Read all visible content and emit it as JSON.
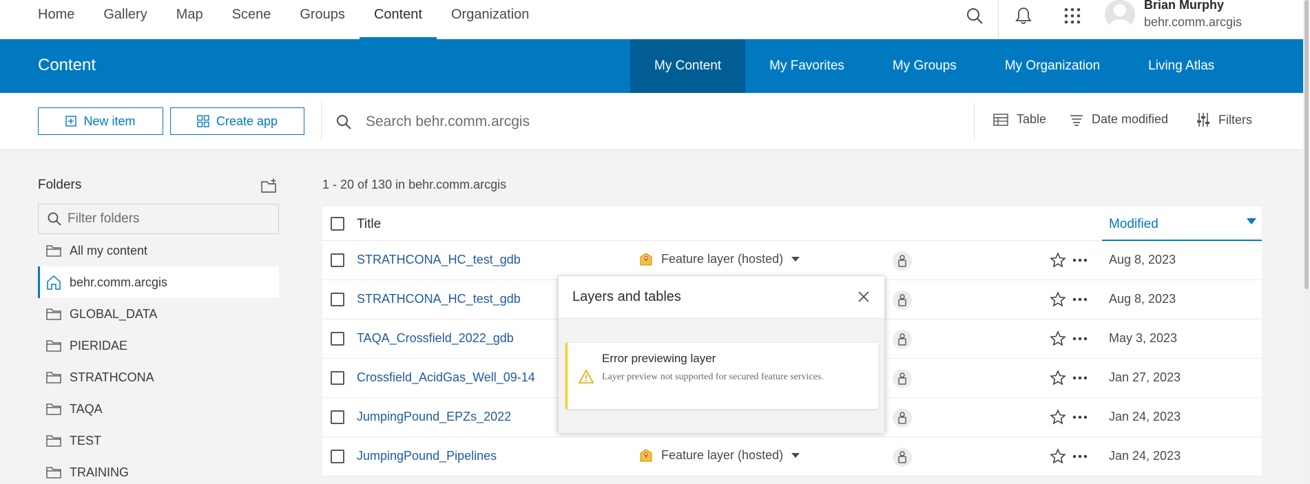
{
  "topnav": {
    "items": [
      {
        "label": "Home"
      },
      {
        "label": "Gallery"
      },
      {
        "label": "Map"
      },
      {
        "label": "Scene"
      },
      {
        "label": "Groups"
      },
      {
        "label": "Content",
        "active": true
      },
      {
        "label": "Organization"
      }
    ],
    "user": {
      "name": "Brian Murphy",
      "org": "behr.comm.arcgis"
    }
  },
  "header": {
    "title": "Content",
    "tabs": [
      {
        "label": "My Content",
        "active": true
      },
      {
        "label": "My Favorites"
      },
      {
        "label": "My Groups"
      },
      {
        "label": "My Organization"
      },
      {
        "label": "Living Atlas"
      }
    ]
  },
  "toolbar": {
    "new_item_label": "New item",
    "create_app_label": "Create app",
    "search_placeholder": "Search behr.comm.arcgis",
    "view_label": "Table",
    "sort_label": "Date modified",
    "filters_label": "Filters"
  },
  "folders": {
    "heading": "Folders",
    "filter_placeholder": "Filter folders",
    "items": [
      {
        "label": "All my content",
        "icon": "folder-icon"
      },
      {
        "label": "behr.comm.arcgis",
        "icon": "home-icon",
        "active": true
      },
      {
        "label": "GLOBAL_DATA",
        "icon": "folder-icon"
      },
      {
        "label": "PIERIDAE",
        "icon": "folder-icon"
      },
      {
        "label": "STRATHCONA",
        "icon": "folder-icon"
      },
      {
        "label": "TAQA",
        "icon": "folder-icon"
      },
      {
        "label": "TEST",
        "icon": "folder-icon"
      },
      {
        "label": "TRAINING",
        "icon": "folder-icon"
      }
    ]
  },
  "results": {
    "count_text": "1 - 20 of 130 in behr.comm.arcgis",
    "columns": {
      "title": "Title",
      "modified": "Modified"
    },
    "rows": [
      {
        "title": "STRATHCONA_HC_test_gdb",
        "type": "Feature layer (hosted)",
        "date": "Aug 8, 2023"
      },
      {
        "title": "STRATHCONA_HC_test_gdb",
        "type": "",
        "date": "Aug 8, 2023"
      },
      {
        "title": "TAQA_Crossfield_2022_gdb",
        "type": "",
        "date": "May 3, 2023"
      },
      {
        "title": "Crossfield_AcidGas_Well_09-14",
        "type": "",
        "date": "Jan 27, 2023"
      },
      {
        "title": "JumpingPound_EPZs_2022",
        "type": "",
        "date": "Jan 24, 2023"
      },
      {
        "title": "JumpingPound_Pipelines",
        "type": "Feature layer (hosted)",
        "date": "Jan 24, 2023"
      }
    ]
  },
  "popup": {
    "title": "Layers and tables",
    "notice_title": "Error previewing layer",
    "notice_message": "Layer preview not supported for secured feature services."
  },
  "colors": {
    "accent": "#0079c1",
    "header_bg": "#0079c1",
    "active_tab_bg": "#005e95",
    "warning": "#edd317",
    "link": "#1f5b9e"
  }
}
